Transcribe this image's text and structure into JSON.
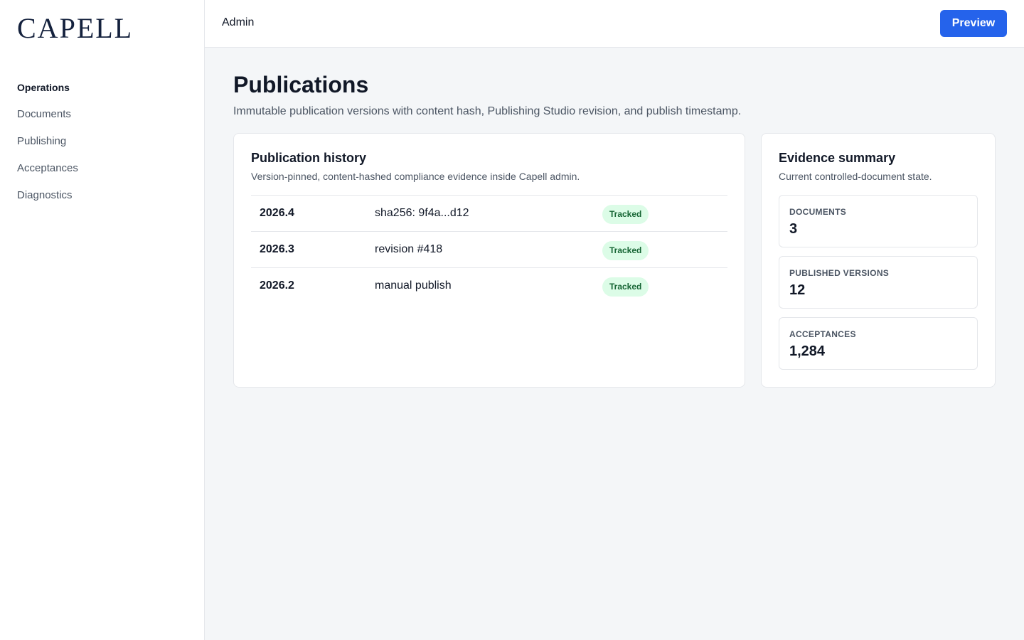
{
  "brand": {
    "logo": "CAPELL"
  },
  "sidebar": {
    "items": [
      {
        "label": "Operations",
        "active": true
      },
      {
        "label": "Documents",
        "active": false
      },
      {
        "label": "Publishing",
        "active": false
      },
      {
        "label": "Acceptances",
        "active": false
      },
      {
        "label": "Diagnostics",
        "active": false
      }
    ]
  },
  "topbar": {
    "title": "Admin",
    "preview_label": "Preview"
  },
  "page": {
    "title": "Publications",
    "subtitle": "Immutable publication versions with content hash, Publishing Studio revision, and publish timestamp."
  },
  "history": {
    "title": "Publication history",
    "description": "Version-pinned, content-hashed compliance evidence inside Capell admin.",
    "rows": [
      {
        "version": "2026.4",
        "detail": "sha256: 9f4a...d12",
        "status": "Tracked"
      },
      {
        "version": "2026.3",
        "detail": "revision #418",
        "status": "Tracked"
      },
      {
        "version": "2026.2",
        "detail": "manual publish",
        "status": "Tracked"
      }
    ]
  },
  "summary": {
    "title": "Evidence summary",
    "description": "Current controlled-document state.",
    "metrics": [
      {
        "label": "DOCUMENTS",
        "value": "3"
      },
      {
        "label": "PUBLISHED VERSIONS",
        "value": "12"
      },
      {
        "label": "ACCEPTANCES",
        "value": "1,284"
      }
    ]
  },
  "colors": {
    "accent": "#2563eb",
    "badge_bg": "#dcfce7",
    "badge_text": "#166534",
    "logo": "#14213d"
  }
}
